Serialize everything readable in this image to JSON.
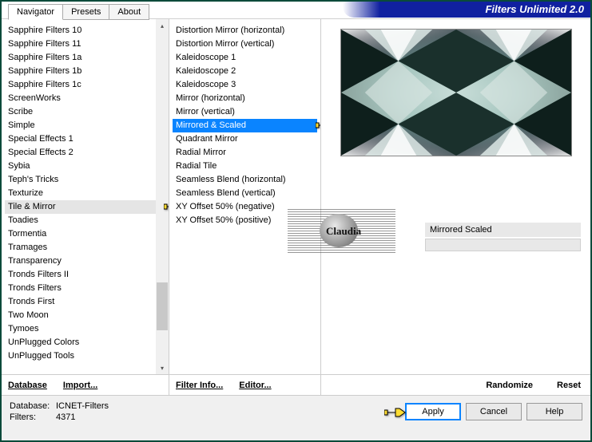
{
  "header": {
    "title": "Filters Unlimited 2.0"
  },
  "tabs": [
    {
      "label": "Navigator",
      "active": true
    },
    {
      "label": "Presets",
      "active": false
    },
    {
      "label": "About",
      "active": false
    }
  ],
  "categories": {
    "items": [
      "Sapphire Filters 10",
      "Sapphire Filters 11",
      "Sapphire Filters 1a",
      "Sapphire Filters 1b",
      "Sapphire Filters 1c",
      "ScreenWorks",
      "Scribe",
      "Simple",
      "Special Effects 1",
      "Special Effects 2",
      "Sybia",
      "Teph's Tricks",
      "Texturize",
      "Tile & Mirror",
      "Toadies",
      "Tormentia",
      "Tramages",
      "Transparency",
      "Tronds Filters II",
      "Tronds Filters",
      "Tronds First",
      "Two Moon",
      "Tymoes",
      "UnPlugged Colors",
      "UnPlugged Tools"
    ],
    "selected_index": 13,
    "buttons": {
      "database": "Database",
      "import": "Import..."
    }
  },
  "filters": {
    "items": [
      "Distortion Mirror (horizontal)",
      "Distortion Mirror (vertical)",
      "Kaleidoscope 1",
      "Kaleidoscope 2",
      "Kaleidoscope 3",
      "Mirror (horizontal)",
      "Mirror (vertical)",
      "Mirrored & Scaled",
      "Quadrant Mirror",
      "Radial Mirror",
      "Radial Tile",
      "Seamless Blend (horizontal)",
      "Seamless Blend (vertical)",
      "XY Offset 50% (negative)",
      "XY Offset 50% (positive)"
    ],
    "selected_index": 7,
    "buttons": {
      "info": "Filter Info...",
      "editor": "Editor..."
    }
  },
  "preview": {
    "param_label": "Mirrored  Scaled",
    "right_buttons": {
      "randomize": "Randomize",
      "reset": "Reset"
    }
  },
  "watermark": {
    "text": "Claudia"
  },
  "status": {
    "db_label": "Database:",
    "db_value": "ICNET-Filters",
    "filters_label": "Filters:",
    "filters_value": "4371"
  },
  "action_buttons": {
    "apply": "Apply",
    "cancel": "Cancel",
    "help": "Help"
  }
}
